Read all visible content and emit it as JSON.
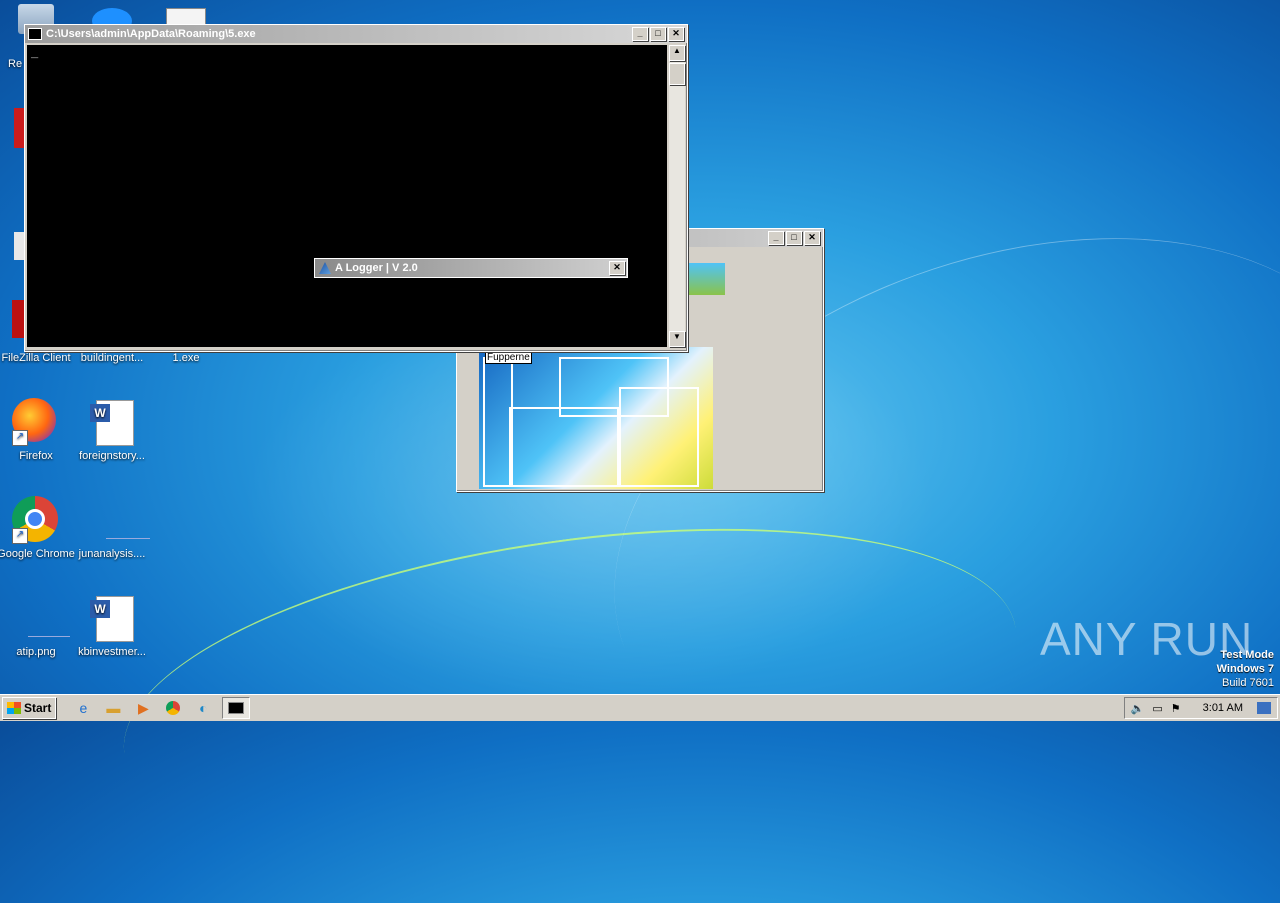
{
  "desktop": {
    "icons": [
      {
        "label": "FileZilla Client"
      },
      {
        "label": "buildingent..."
      },
      {
        "label": "1.exe"
      },
      {
        "label": "Firefox"
      },
      {
        "label": "foreignstory..."
      },
      {
        "label": "Google Chrome"
      },
      {
        "label": "junanalysis...."
      },
      {
        "label": "atip.png"
      },
      {
        "label": "kbinvestmer..."
      }
    ],
    "watermark": {
      "brand": "ANY RUN",
      "test_mode": "Test Mode",
      "os": "Windows 7",
      "build": "Build 7601"
    }
  },
  "console_window": {
    "title": "C:\\Users\\admin\\AppData\\Roaming\\5.exe",
    "cursor": "_"
  },
  "logger_dialog": {
    "title": "A Logger | V 2.0",
    "close_label": "✕"
  },
  "background_window": {
    "label": "Fupperne"
  },
  "taskbar": {
    "start_label": "Start",
    "clock": "3:01 AM"
  },
  "colors": {
    "desktop": "#1f86d6",
    "window_face": "#d4d0c8",
    "console_bg": "#000000"
  }
}
